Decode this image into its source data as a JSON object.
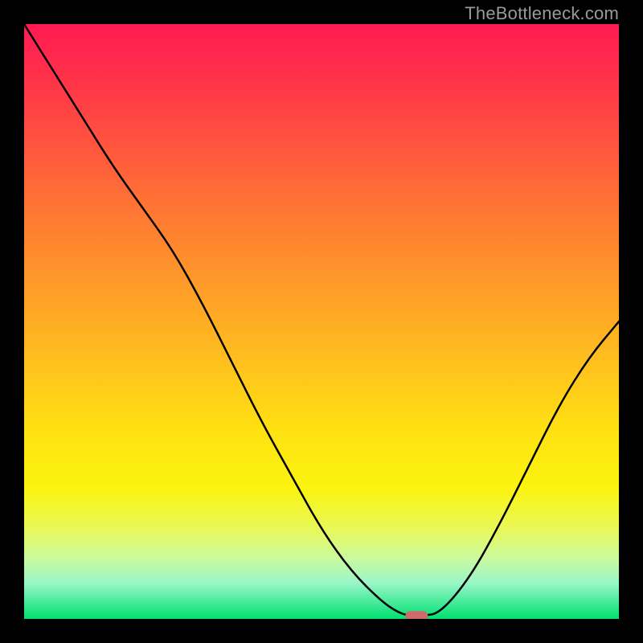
{
  "watermark": "TheBottleneck.com",
  "colors": {
    "background": "#000000",
    "gradient_top": "#ff1a52",
    "gradient_bottom": "#00e070",
    "curve": "#000000",
    "marker": "#cc6b6b"
  },
  "chart_data": {
    "type": "line",
    "title": "",
    "xlabel": "",
    "ylabel": "",
    "xlim": [
      0,
      100
    ],
    "ylim": [
      0,
      100
    ],
    "x": [
      0,
      5,
      10,
      15,
      20,
      25,
      30,
      35,
      40,
      45,
      50,
      55,
      60,
      63,
      65,
      67,
      70,
      75,
      80,
      85,
      90,
      95,
      100
    ],
    "values": [
      100,
      92,
      84,
      76,
      69,
      62,
      53,
      43,
      33,
      24,
      15,
      8,
      3,
      1,
      0.5,
      0.5,
      1,
      7,
      16,
      26,
      36,
      44,
      50
    ],
    "marker": {
      "x": 66,
      "y": 0.5
    },
    "note": "Values are percentages read from the vertical position of the curve within the plot area (0 = bottom baseline, 100 = top). X is horizontal position percentage left→right."
  }
}
